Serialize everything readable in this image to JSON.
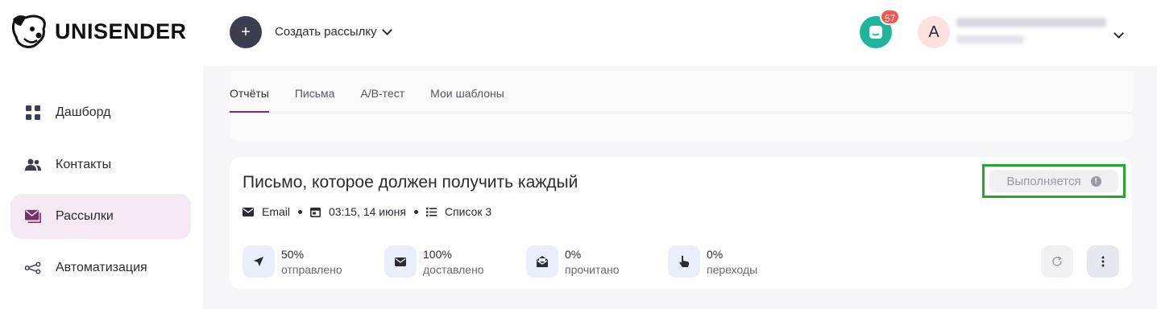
{
  "brand": {
    "name": "UNISENDER"
  },
  "header": {
    "create_icon": "+",
    "create_label": "Создать рассылку",
    "chat_badge": "57",
    "avatar_letter": "A"
  },
  "sidebar": {
    "items": [
      {
        "label": "Дашборд",
        "icon": "grid-icon"
      },
      {
        "label": "Контакты",
        "icon": "users-icon"
      },
      {
        "label": "Рассылки",
        "icon": "mail-icon",
        "active": true
      },
      {
        "label": "Автоматизация",
        "icon": "flow-icon"
      }
    ]
  },
  "tabs": [
    {
      "label": "Отчёты",
      "active": true
    },
    {
      "label": "Письма"
    },
    {
      "label": "A/B-тест"
    },
    {
      "label": "Мои шаблоны"
    }
  ],
  "campaign": {
    "title": "Письмо, которое должен получить каждый",
    "status": "Выполняется",
    "status_info": "!",
    "type": "Email",
    "datetime": "03:15, 14 июня",
    "list": "Список 3",
    "stats": [
      {
        "value": "50%",
        "label": "отправлено",
        "icon": "send-icon"
      },
      {
        "value": "100%",
        "label": "доставлено",
        "icon": "envelope-icon"
      },
      {
        "value": "0%",
        "label": "прочитано",
        "icon": "open-envelope-icon"
      },
      {
        "value": "0%",
        "label": "переходы",
        "icon": "pointer-icon"
      }
    ]
  },
  "colors": {
    "accent": "#7a2f6a",
    "chat": "#1fb59d",
    "badge": "#f0574d",
    "highlight": "#22a82b"
  }
}
